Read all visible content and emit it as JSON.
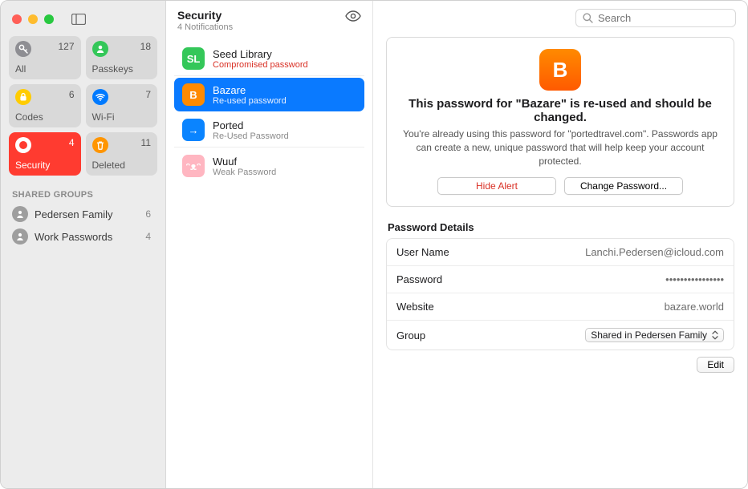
{
  "sidebar": {
    "tiles": [
      {
        "label": "All",
        "count": 127,
        "icon": "key",
        "color": "#8e8e93"
      },
      {
        "label": "Passkeys",
        "count": 18,
        "icon": "person",
        "color": "#34c759"
      },
      {
        "label": "Codes",
        "count": 6,
        "icon": "lock",
        "color": "#ffcc00"
      },
      {
        "label": "Wi-Fi",
        "count": 7,
        "icon": "wifi",
        "color": "#007aff"
      },
      {
        "label": "Security",
        "count": 4,
        "icon": "alert",
        "color": "#ff3b30",
        "active": true
      },
      {
        "label": "Deleted",
        "count": 11,
        "icon": "trash",
        "color": "#ff9500"
      }
    ],
    "shared_groups_header": "SHARED GROUPS",
    "shared_groups": [
      {
        "label": "Pedersen Family",
        "count": 6
      },
      {
        "label": "Work Passwords",
        "count": 4
      }
    ]
  },
  "midcol": {
    "title": "Security",
    "subtitle": "4 Notifications",
    "items": [
      {
        "title": "Seed Library",
        "subtitle": "Compromised password",
        "subtitle_danger": true,
        "icon_bg": "#34c759",
        "icon_txt": "SL"
      },
      {
        "title": "Bazare",
        "subtitle": "Re-used password",
        "subtitle_danger": false,
        "icon_bg": "#ff8a00",
        "icon_txt": "B",
        "selected": true
      },
      {
        "title": "Ported",
        "subtitle": "Re-Used Password",
        "subtitle_danger": false,
        "icon_bg": "#0a84ff",
        "icon_txt": "→"
      },
      {
        "title": "Wuuf",
        "subtitle": "Weak Password",
        "subtitle_danger": false,
        "icon_bg": "#ffb6c1",
        "icon_txt": "ᵔᴥᵔ"
      }
    ]
  },
  "detail": {
    "search_placeholder": "Search",
    "alert": {
      "icon_letter": "B",
      "title": "This password for \"Bazare\" is re-used and should be changed.",
      "body": "You're already using this password for \"portedtravel.com\". Passwords app can create a new, unique password that will help keep your account protected.",
      "hide_label": "Hide Alert",
      "change_label": "Change Password..."
    },
    "details_header": "Password Details",
    "rows": {
      "username_key": "User Name",
      "username_val": "Lanchi.Pedersen@icloud.com",
      "password_key": "Password",
      "password_val": "••••••••••••••••",
      "website_key": "Website",
      "website_val": "bazare.world",
      "group_key": "Group",
      "group_val": "Shared in Pedersen Family"
    },
    "edit_label": "Edit"
  }
}
